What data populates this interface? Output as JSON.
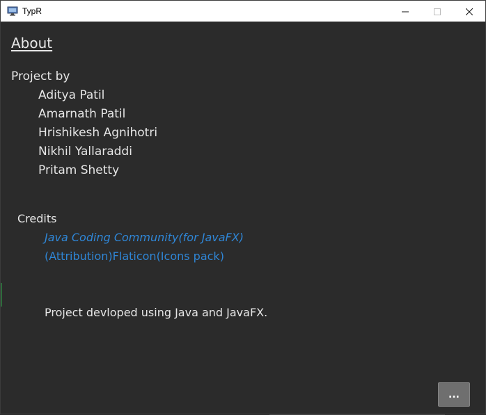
{
  "window": {
    "title": "TypR",
    "app_icon": "monitor-icon",
    "controls": {
      "minimize": "minimize-icon",
      "maximize": "maximize-icon",
      "close": "close-icon"
    }
  },
  "about": {
    "heading": "About"
  },
  "project": {
    "label": "Project by",
    "authors": [
      "Aditya Patil",
      "Amarnath Patil",
      "Hrishikesh Agnihotri",
      "Nikhil Yallaraddi",
      "Pritam Shetty"
    ]
  },
  "credits": {
    "label": "Credits",
    "links": [
      "Java Coding Community(for JavaFX)",
      "(Attribution)Flaticon(Icons pack)"
    ]
  },
  "footer": {
    "text": "Project devloped using Java and JavaFX."
  },
  "more_button": {
    "label": "..."
  },
  "colors": {
    "background": "#2b2b2b",
    "text": "#e6e6e6",
    "link": "#2f86d6",
    "button": "#6f6f6f"
  }
}
